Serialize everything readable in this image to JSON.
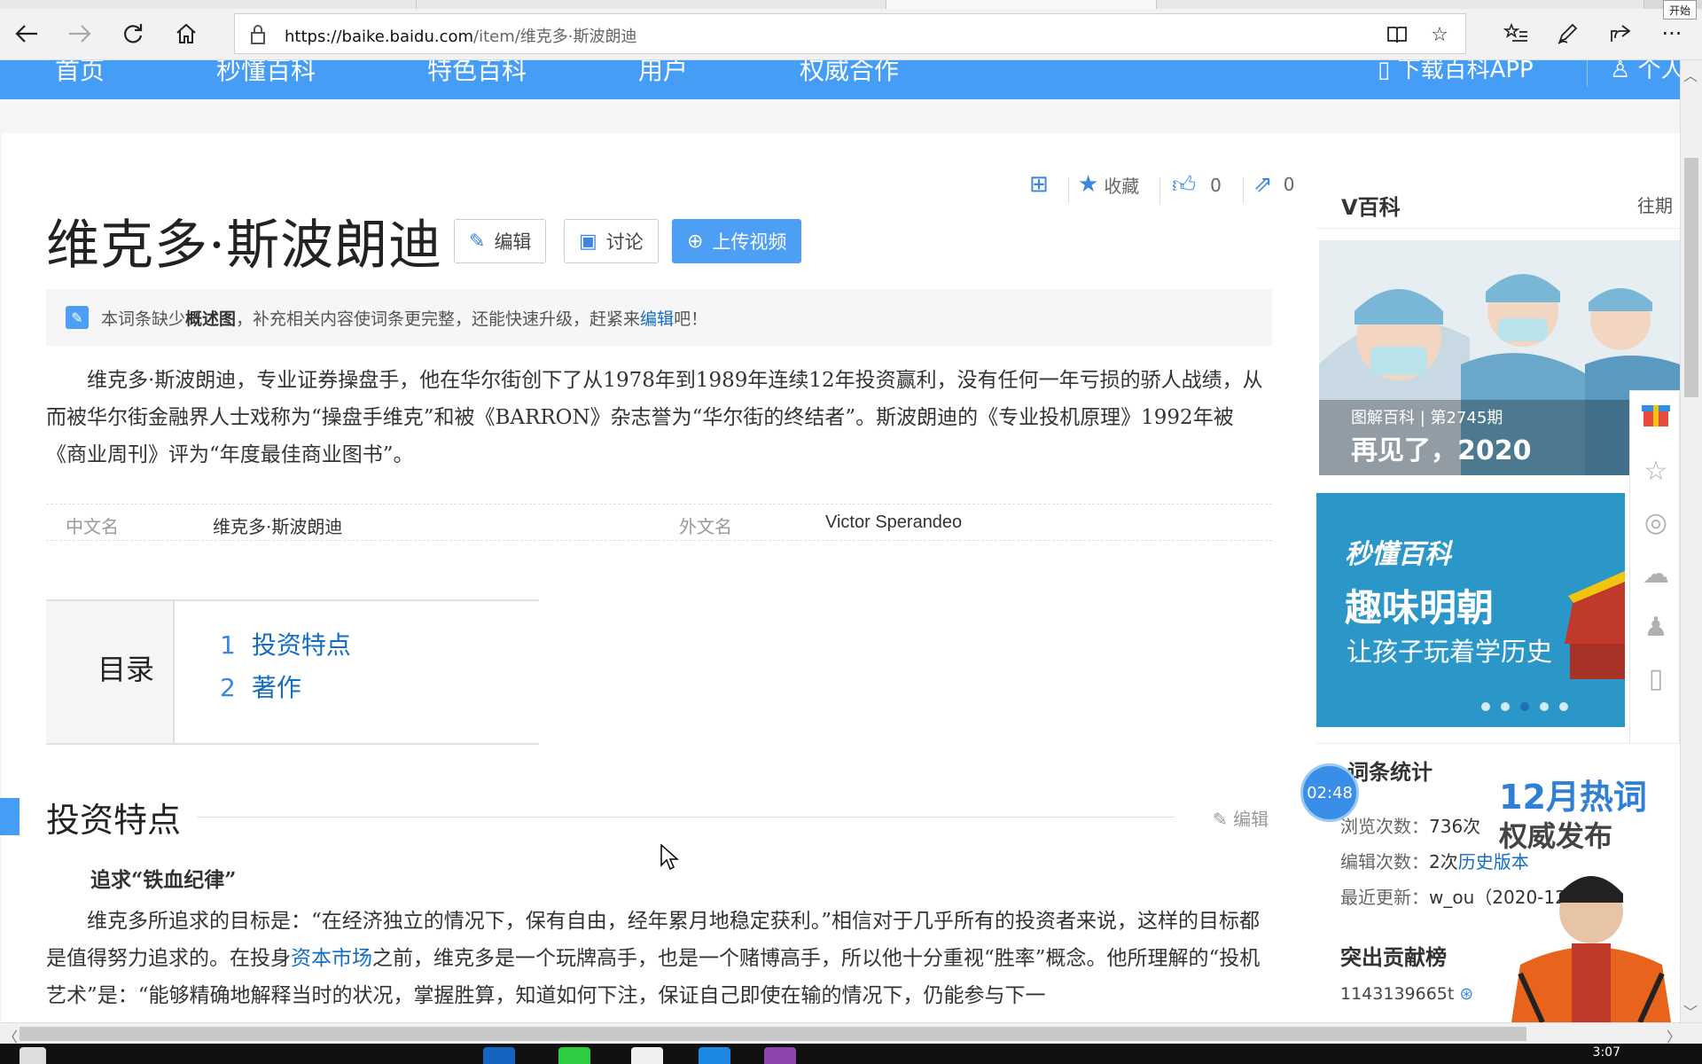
{
  "browser": {
    "url_host": "https://baike.baidu.com",
    "url_path": "/item/维克多·斯波朗迪",
    "start_tooltip": "开始",
    "icons": [
      "back-icon",
      "forward-icon",
      "refresh-icon",
      "home-icon",
      "lock-icon",
      "reading-view-icon",
      "favorite-star-icon",
      "favorites-list-icon",
      "pen-icon",
      "share-icon",
      "more-icon"
    ]
  },
  "nav": {
    "items": [
      "首页",
      "秒懂百科",
      "特色百科",
      "用户",
      "权威合作"
    ],
    "download_app": "下载百科APP",
    "personal": "个人"
  },
  "tools": {
    "favorite": "收藏",
    "like_count": "0",
    "share_count": "0"
  },
  "article": {
    "title": "维克多·斯波朗迪",
    "edit_button": "编辑",
    "discuss_button": "讨论",
    "upload_video_button": "上传视频",
    "notice_pre": "本词条缺少",
    "notice_bold": "概述图",
    "notice_mid": "，补充相关内容使词条更完整，还能快速升级，赶紧来",
    "notice_link": "编辑",
    "notice_post": "吧！",
    "intro": "维克多·斯波朗迪，专业证券操盘手，他在华尔街创下了从1978年到1989年连续12年投资赢利，没有任何一年亏损的骄人战绩，从而被华尔街金融界人士戏称为“操盘手维克”和被《BARRON》杂志誉为“华尔街的终结者”。斯波朗迪的《专业投机原理》1992年被《商业周刊》评为“年度最佳商业图书”。",
    "basic_info": {
      "k1": "中文名",
      "v1": "维克多·斯波朗迪",
      "k2": "外文名",
      "v2": "Victor Sperandeo"
    },
    "toc": {
      "label": "目录",
      "entries": [
        {
          "num": "1",
          "text": "投资特点"
        },
        {
          "num": "2",
          "text": "著作"
        }
      ]
    },
    "section_title": "投资特点",
    "section_edit": "编辑",
    "sub_title": "追求“铁血纪律”",
    "para2_a": "维克多所追求的目标是：“在经济独立的情况下，保有自由，经年累月地稳定获利。”相信对于几乎所有的投资者来说，这样的目标都是值得努力追求的。在投身",
    "para2_link": "资本市场",
    "para2_b": "之前，维克多是一个玩牌高手，也是一个赌博高手，所以他十分重视“胜率”概念。他所理解的“投机艺术”是：“能够精确地解释当时的状况，掌握胜算，知道如何下注，保证自己即使在输的情况下，仍能参与下一"
  },
  "sidebar": {
    "v_title": "V百科",
    "v_more": "往期",
    "v_caption_small": "图解百科 | 第2745期",
    "v_caption_big": "再见了，2020",
    "ad_brand": "秒懂百科",
    "ad_headline": "趣味明朝",
    "ad_sub": "让孩子玩着学历史",
    "ad_dots": 5,
    "ad_active_dot": 3,
    "stats_title": "词条统计",
    "views_label": "浏览次数：",
    "views_value": "736次",
    "edits_label": "编辑次数：",
    "edits_value": "2次",
    "history_link": "历史版本",
    "updated_label": "最近更新：",
    "updated_value": "w_ou（2020-12-",
    "contrib_title": "突出贡献榜",
    "contrib_user": "1143139665t",
    "timer": "02:48",
    "hot_line1": "12月热词",
    "hot_line2": "权威发布"
  },
  "taskbar": {
    "clock": "3:07"
  },
  "colors": {
    "brand_blue": "#459df5",
    "link": "#136ec2"
  }
}
